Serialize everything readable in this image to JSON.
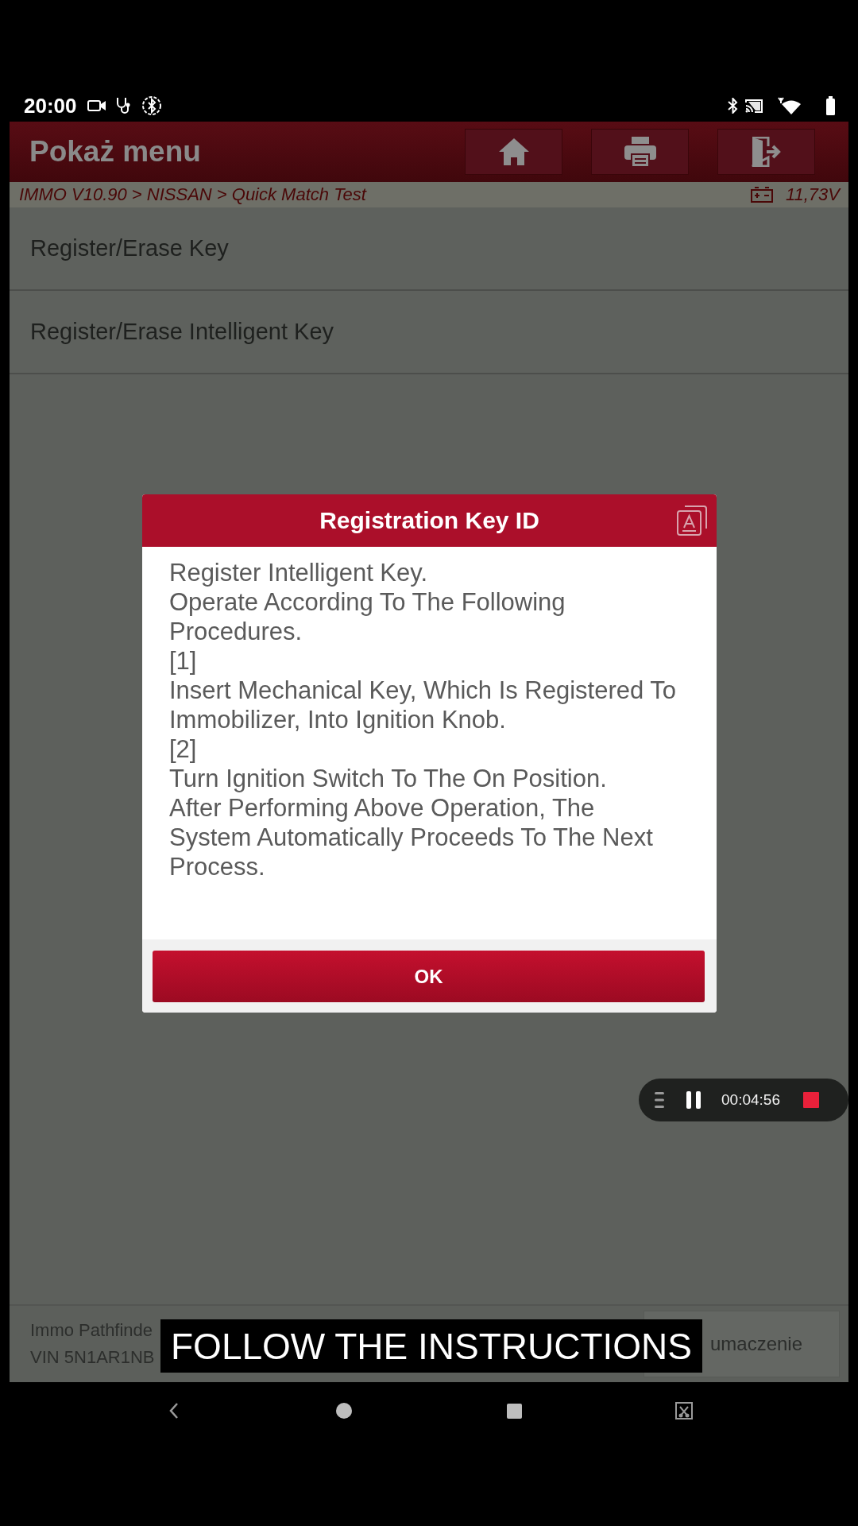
{
  "status_bar": {
    "time": "20:00"
  },
  "header": {
    "title": "Pokaż menu"
  },
  "breadcrumb": {
    "path": "IMMO V10.90 > NISSAN > Quick Match Test",
    "voltage": "11,73V"
  },
  "menu": {
    "items": [
      "Register/Erase Key",
      "Register/Erase Intelligent Key"
    ]
  },
  "dialog": {
    "title": "Registration Key ID",
    "message": "Register Intelligent Key.\nOperate According To The Following\nProcedures.\n[1]\nInsert Mechanical Key, Which Is Registered To\nImmobilizer, Into Ignition Knob.\n[2]\nTurn Ignition Switch To The On Position.\nAfter Performing Above Operation, The\nSystem Automatically Proceeds To The Next\nProcess.",
    "button": "OK"
  },
  "recording": {
    "time": "00:04:56"
  },
  "bottom_bar": {
    "info_lines": [
      "Immo Pathfinde",
      "VIN 5N1AR1NB"
    ],
    "button": "umaczenie"
  },
  "caption": "FOLLOW THE INSTRUCTIONS"
}
